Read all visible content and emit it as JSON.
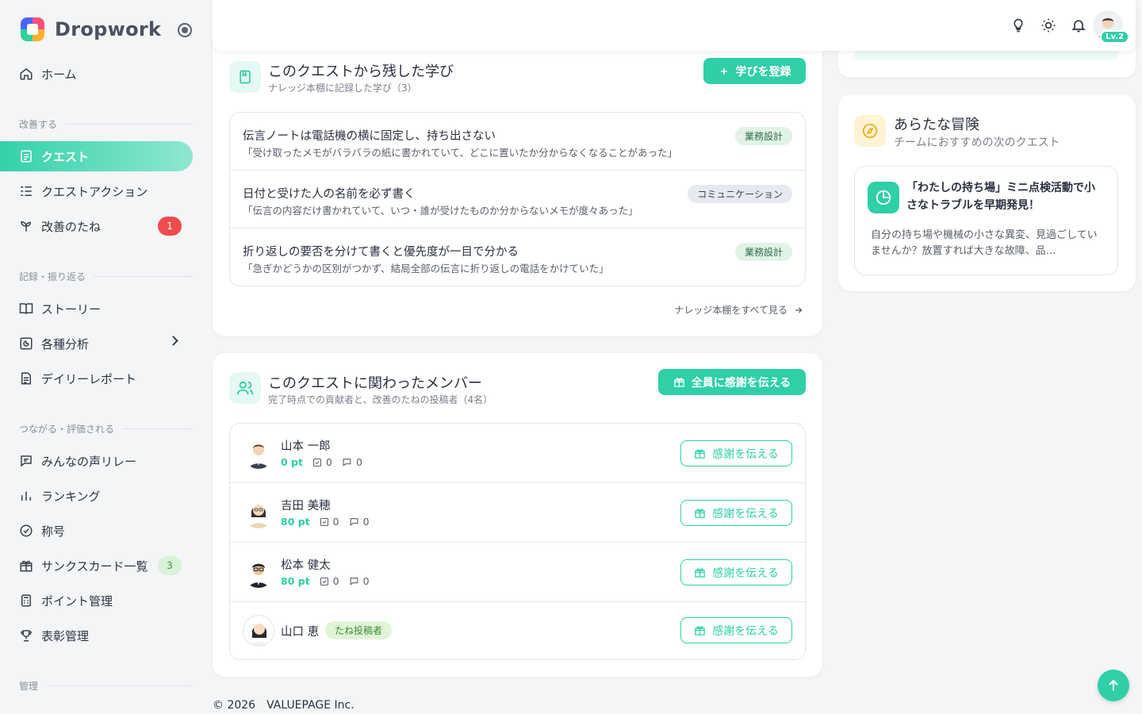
{
  "brand": {
    "name": "Dropwork"
  },
  "nav": {
    "home": "ホーム",
    "section_improve": "改善する",
    "quest": "クエスト",
    "quest_action": "クエストアクション",
    "seeds": "改善のたね",
    "seeds_badge": "1",
    "section_record": "記録・振り返る",
    "story": "ストーリー",
    "analysis": "各種分析",
    "daily_report": "デイリーレポート",
    "section_connect": "つながる・評価される",
    "voice_relay": "みんなの声リレー",
    "ranking": "ランキング",
    "titles": "称号",
    "thanks_cards": "サンクスカード一覧",
    "thanks_badge": "3",
    "points": "ポイント管理",
    "awards": "表彰管理",
    "section_admin": "管理"
  },
  "topbar": {
    "icons": [
      "lightbulb-icon",
      "sun-icon",
      "bell-icon"
    ],
    "level": "Lv.2"
  },
  "learnings": {
    "title": "このクエストから残した学び",
    "subtitle": "ナレッジ本棚に記録した学び（3）",
    "register_button": "学びを登録",
    "items": [
      {
        "title": "伝言ノートは電話機の横に固定し、持ち出さない",
        "quote": "「受け取ったメモがバラバラの紙に書かれていて、どこに置いたか分からなくなることがあった」",
        "tag": "業務設計"
      },
      {
        "title": "日付と受けた人の名前を必ず書く",
        "quote": "「伝言の内容だけ書かれていて、いつ・誰が受けたものか分からないメモが度々あった」",
        "tag": "コミュニケーション"
      },
      {
        "title": "折り返しの要否を分けて書くと優先度が一目で分かる",
        "quote": "「急ぎかどうかの区別がつかず、結局全部の伝言に折り返しの電話をかけていた」",
        "tag": "業務設計"
      }
    ],
    "see_all": "ナレッジ本棚をすべて見る"
  },
  "members": {
    "title": "このクエストに関わったメンバー",
    "subtitle": "完了時点での貢献者と、改善のたねの投稿者（4名）",
    "thank_all_button": "全員に感謝を伝える",
    "thank_button": "感謝を伝える",
    "items": [
      {
        "name": "山本 一郎",
        "points": "0 pt",
        "tasks": "0",
        "comments": "0"
      },
      {
        "name": "吉田 美穂",
        "points": "80 pt",
        "tasks": "0",
        "comments": "0"
      },
      {
        "name": "松本 健太",
        "points": "80 pt",
        "tasks": "0",
        "comments": "0"
      },
      {
        "name": "山口 恵",
        "tag": "たね投稿者"
      }
    ]
  },
  "adventure": {
    "title": "あらたな冒険",
    "subtitle": "チームにおすすめの次のクエスト",
    "quest_title": "「わたしの持ち場」ミニ点検活動で小さなトラブルを早期発見！",
    "quest_desc": "自分の持ち場や機械の小さな異変、見過ごしていませんか？放置すれば大きな故障、品…"
  },
  "footer": {
    "copyright": "© 2026　VALUEPAGE Inc."
  },
  "colors": {
    "accent": "#2fcfa8",
    "danger": "#f04c4c",
    "amber": "#f0b020"
  }
}
